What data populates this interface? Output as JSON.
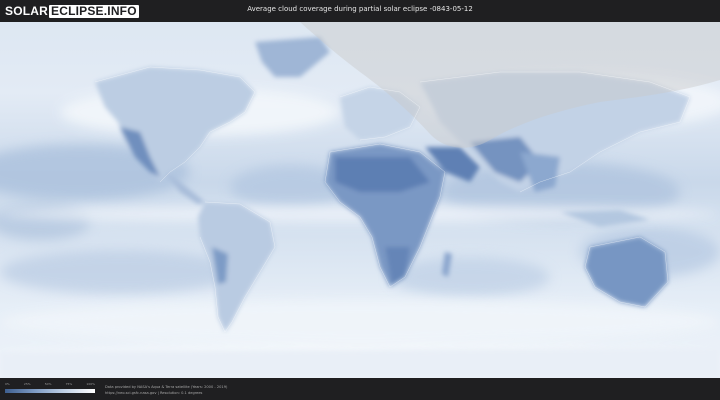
{
  "header": {
    "logo_part1": "SOLAR",
    "logo_part2": "ECLIPSE.INFO",
    "title": "Average cloud coverage during partial solar eclipse -0843-05-12"
  },
  "legend": {
    "ticks": [
      "0%",
      "25%",
      "50%",
      "75%",
      "100%"
    ],
    "low_color": "#3e5f8f",
    "high_color": "#ffffff"
  },
  "footer": {
    "credit_line1": "Data provided by NASA's Aqua & Terra satellite (Years: 2000 - 2019)",
    "credit_line2": "https://neo.sci.gsfc.nasa.gov | Resolution: 0.1 degrees"
  },
  "map": {
    "eclipse_overlay_color": "#c9c9c9",
    "land_clear_color": "#6e8fbf",
    "cloud_color": "#f4f7fb"
  }
}
